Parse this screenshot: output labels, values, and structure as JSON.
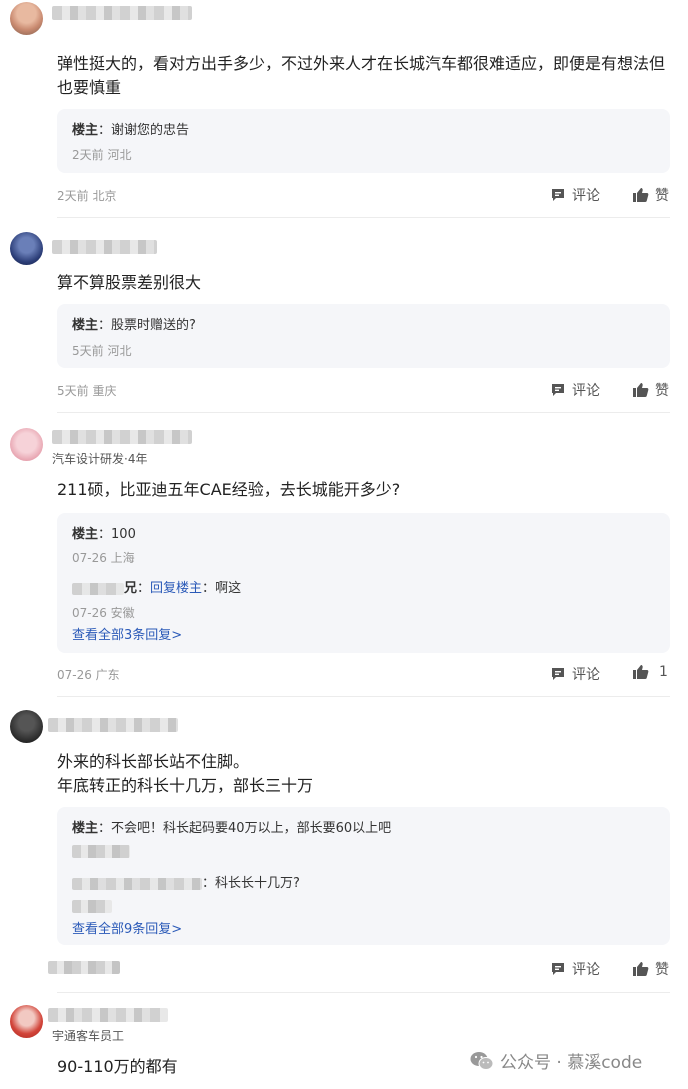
{
  "comments": [
    {
      "content": "弹性挺大的，看对方出手多少，不过外来人才在长城汽车都很难适应，即便是有想法但也要慎重",
      "replies": [
        {
          "who": "楼主",
          "text": "谢谢您的忠告",
          "meta": "2天前 河北"
        }
      ],
      "meta": "2天前 北京",
      "comment_label": "评论",
      "like_label": "赞"
    },
    {
      "content": "算不算股票差别很大",
      "replies": [
        {
          "who": "楼主",
          "text": "股票时赠送的?",
          "meta": "5天前 河北"
        }
      ],
      "meta": "5天前 重庆",
      "comment_label": "评论",
      "like_label": "赞"
    },
    {
      "subtitle": "汽车设计研发·4年",
      "content": "211硕，比亚迪五年CAE经验，去长城能开多少?",
      "replies": [
        {
          "who": "楼主",
          "text": "100",
          "meta": "07-26 上海"
        },
        {
          "who_suffix": "兄",
          "reply_to": "回复楼主",
          "text": "啊这",
          "meta": "07-26 安徽"
        }
      ],
      "view_all": "查看全部3条回复>",
      "meta": "07-26 广东",
      "comment_label": "评论",
      "like_label": "1"
    },
    {
      "content_lines": [
        "外来的科长部长站不住脚。",
        "年底转正的科长十几万，部长三十万"
      ],
      "replies": [
        {
          "who": "楼主",
          "text": "不会吧！科长起码要40万以上，部长要60以上吧"
        },
        {
          "text": "科长长十几万?"
        }
      ],
      "view_all": "查看全部9条回复>",
      "comment_label": "评论",
      "like_label": "赞"
    },
    {
      "subtitle": "宇通客车员工",
      "content": "90-110万的都有"
    }
  ],
  "watermark": {
    "text": "公众号 · 慕溪code",
    "icon": "wechat-icon"
  }
}
